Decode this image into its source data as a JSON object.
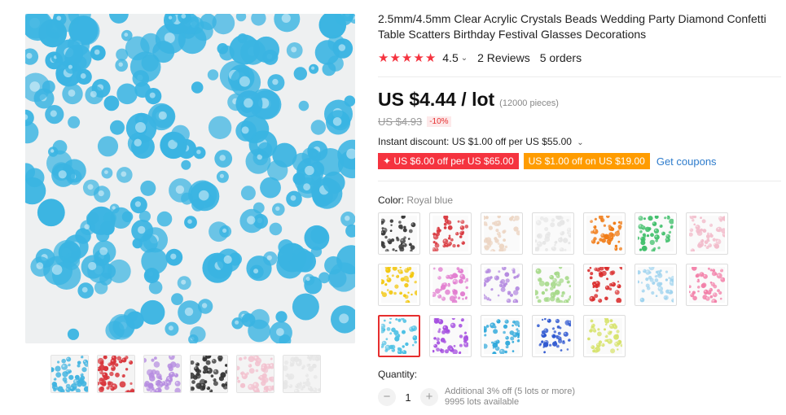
{
  "product": {
    "title": "2.5mm/4.5mm Clear Acrylic Crystals Beads Wedding Party Diamond Confetti Table Scatters Birthday Festival Glasses Decorations",
    "rating": "4.5",
    "reviews": "2 Reviews",
    "orders": "5 orders"
  },
  "price": {
    "current": "US $4.44 / lot",
    "pieces": "(12000 pieces)",
    "original": "US $4.93",
    "discount": "-10%",
    "instant_discount": "Instant discount: US $1.00 off per US $55.00"
  },
  "coupons": {
    "coupon1": "US $6.00 off per US $65.00",
    "coupon2": "US $1.00 off on US $19.00",
    "get_coupons": "Get coupons"
  },
  "color": {
    "label": "Color: ",
    "selected": "Royal blue",
    "swatches": [
      "#3a3a3a",
      "#d8353b",
      "#ecd5c3",
      "#e6e6e6",
      "#f07b16",
      "#3fbf6a",
      "#f2bccb",
      "#f2c70f",
      "#e27fd0",
      "#b58be0",
      "#a6d98a",
      "#d92a2a",
      "#9fd3ee",
      "#f27fa8",
      "#4cc0e4",
      "#a54fe0",
      "#31a9db",
      "#2f58d0",
      "#d6e26a"
    ],
    "selected_index": 14
  },
  "thumbnails": [
    "#3fb3e0",
    "#d8353b",
    "#b58be0",
    "#333333",
    "#f2c2cf",
    "#e6e6e6"
  ],
  "main_image_color": "#3ab4e2",
  "quantity": {
    "label": "Quantity:",
    "value": "1",
    "minus": "−",
    "plus": "+",
    "note1": "Additional 3% off (5 lots or more)",
    "note2": "9995 lots available"
  }
}
